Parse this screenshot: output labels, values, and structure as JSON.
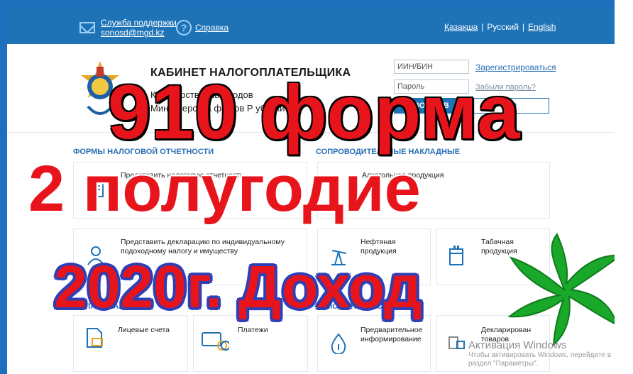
{
  "topbar": {
    "support_line1": "Служба поддержки",
    "support_line2": "sonosd@mgd.kz",
    "help": "Справка",
    "langs": [
      "Қазақша",
      "Русский",
      "English"
    ]
  },
  "header": {
    "title": "КАБИНЕТ НАЛОГОПЛАТЕЛЬЩИКА",
    "subtitle1": "Ком   дарственных   ходов",
    "subtitle2": "Министерства фин   ов Р   ублики К",
    "iin_placeholder": "ИИН/БИН",
    "password_placeholder": "Пароль",
    "login_button": "ВОЙТИ В",
    "eds_button": "ПО",
    "register_link": "Зарегистрироваться",
    "forgot_link": "Забыли пароль?"
  },
  "sections": {
    "forms": "ФОРМЫ НАЛОГОВОЙ ОТЧЕТНОСТИ",
    "invoices": "СОПРОВОДИТЕЛЬНЫЕ НАКЛАДНЫЕ",
    "payments": "ОПЛАТА НАЛОГОВ",
    "customs": "ТАМОЖЕННЫЕ СЕРВИСЫ"
  },
  "cards": {
    "submit_report": "Представить налоговую отчетность",
    "alcohol": "Алкогольная продукция",
    "declaration_line1": "Представить декларацию по индивидуальному",
    "declaration_line2": "подоходному налогу и имуществу",
    "oil_line1": "Нефтяная",
    "oil_line2": "продукция",
    "tobacco_line1": "Табачная",
    "tobacco_line2": "продукция",
    "accounts": "Лицевые счета",
    "payments": "Платежи",
    "prelim_line1": "Предварительное",
    "prelim_line2": "информирование",
    "declaring_line1": "Декларирован",
    "declaring_line2": "товаров"
  },
  "overlay": {
    "line1": "910 форма",
    "line2": "2 полугодие",
    "line3": "2020г. Доход"
  },
  "watermark": {
    "title": "Активация Windows",
    "line1": "Чтобы активировать Windows, перейдите в",
    "line2": "раздел \"Параметры\"."
  },
  "colors": {
    "brand_blue": "#1e73b7",
    "overlay_red": "#e8141b",
    "overlay_outline_blue": "#2f3fb5",
    "star_green": "#1aa82a"
  }
}
